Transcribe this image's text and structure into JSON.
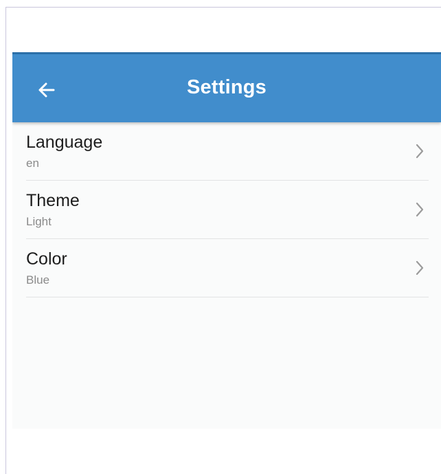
{
  "header": {
    "title": "Settings",
    "back_icon": "arrow-left-icon",
    "background_color": "#418dcc"
  },
  "settings": {
    "items": [
      {
        "label": "Language",
        "value": "en",
        "icon": "chevron-right-icon"
      },
      {
        "label": "Theme",
        "value": "Light",
        "icon": "chevron-right-icon"
      },
      {
        "label": "Color",
        "value": "Blue",
        "icon": "chevron-right-icon"
      }
    ]
  }
}
